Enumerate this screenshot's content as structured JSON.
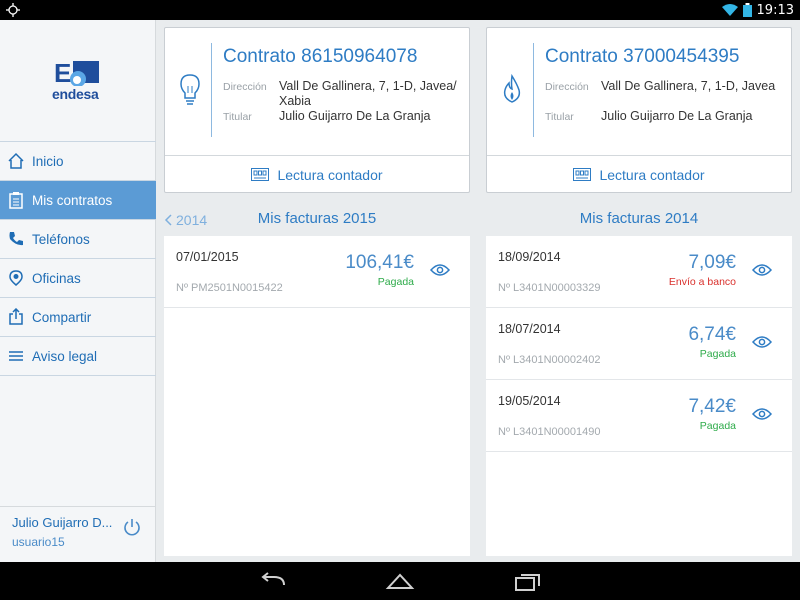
{
  "status_bar": {
    "time": "19:13"
  },
  "sidebar": {
    "logo_text": "endesa",
    "items": [
      {
        "label": "Inicio",
        "icon": "home-icon"
      },
      {
        "label": "Mis contratos",
        "icon": "clipboard-icon",
        "active": true
      },
      {
        "label": "Teléfonos",
        "icon": "phone-icon"
      },
      {
        "label": "Oficinas",
        "icon": "location-icon"
      },
      {
        "label": "Compartir",
        "icon": "share-icon"
      },
      {
        "label": "Aviso legal",
        "icon": "menu-lines-icon"
      }
    ],
    "user": {
      "name": "Julio Guijarro D...",
      "login": "usuario15"
    }
  },
  "contracts": [
    {
      "title": "Contrato 86150964078",
      "icon": "lightbulb-icon",
      "address_label": "Dirección",
      "address": "Vall De Gallinera, 7, 1-D, Javea/ Xabia",
      "holder_label": "Titular",
      "holder": "Julio Guijarro De La Granja",
      "meter_label": "Lectura contador"
    },
    {
      "title": "Contrato 37000454395",
      "icon": "flame-icon",
      "address_label": "Dirección",
      "address": "Vall De Gallinera, 7, 1-D, Javea",
      "holder_label": "Titular",
      "holder": "Julio Guijarro De La Granja",
      "meter_label": "Lectura contador"
    }
  ],
  "invoices_2015": {
    "prev_label": "2014",
    "title": "Mis facturas 2015",
    "rows": [
      {
        "date": "07/01/2015",
        "number": "Nº PM2501N0015422",
        "amount": "106,41€",
        "status": "Pagada"
      }
    ]
  },
  "invoices_2014": {
    "title": "Mis facturas 2014",
    "rows": [
      {
        "date": "18/09/2014",
        "number": "Nº L3401N00003329",
        "amount": "7,09€",
        "status": "Envío a banco"
      },
      {
        "date": "18/07/2014",
        "number": "Nº L3401N00002402",
        "amount": "6,74€",
        "status": "Pagada"
      },
      {
        "date": "19/05/2014",
        "number": "Nº L3401N00001490",
        "amount": "7,42€",
        "status": "Pagada"
      }
    ]
  },
  "colors": {
    "accent": "#2e7cc4",
    "active_nav": "#5b9bd5",
    "paid": "#2eab4a",
    "bank": "#d9302c"
  }
}
